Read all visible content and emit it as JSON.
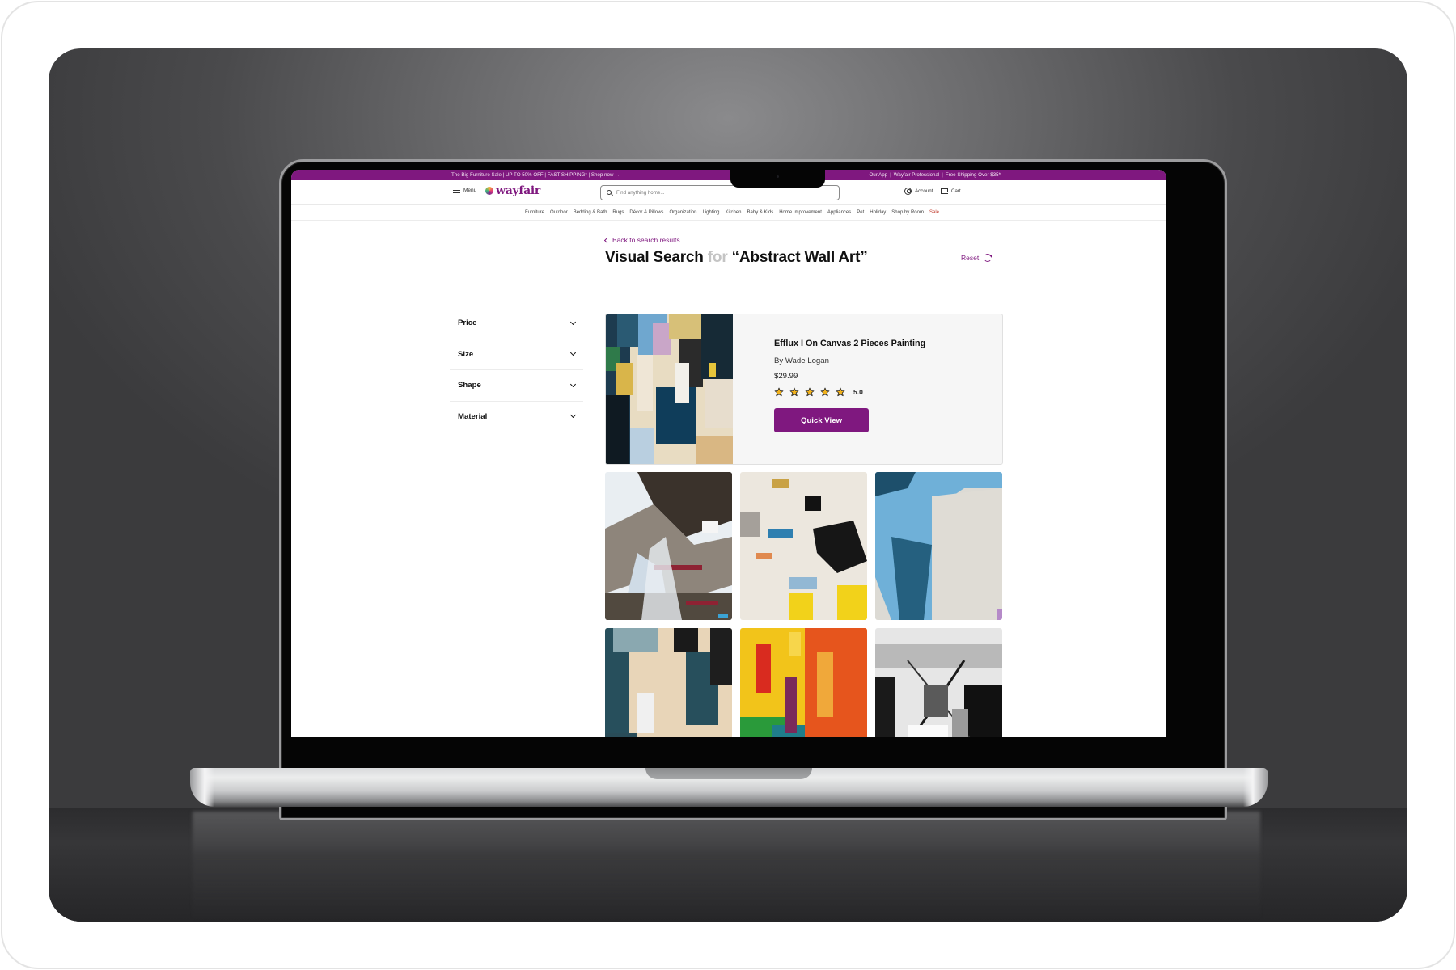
{
  "promo_bar": {
    "left_text": "The Big Furniture Sale | UP TO 50% OFF | FAST SHIPPING* | Shop now →",
    "right_items": [
      "Our App",
      "Wayfair Professional",
      "Free Shipping Over $35*"
    ]
  },
  "header": {
    "menu_label": "Menu",
    "logo_text": "wayfair",
    "search_placeholder": "Find anything home...",
    "search_value": "",
    "account_label": "Account",
    "cart_label": "Cart"
  },
  "category_nav": [
    "Furniture",
    "Outdoor",
    "Bedding & Bath",
    "Rugs",
    "Décor & Pillows",
    "Organization",
    "Lighting",
    "Kitchen",
    "Baby & Kids",
    "Home Improvement",
    "Appliances",
    "Pet",
    "Holiday",
    "Shop by Room",
    "Sale"
  ],
  "page": {
    "back_link": "Back to search results",
    "title_main": "Visual Search",
    "title_connector": "for",
    "title_query": "“Abstract Wall Art”",
    "reset_label": "Reset"
  },
  "filters": [
    {
      "label": "Price"
    },
    {
      "label": "Size"
    },
    {
      "label": "Shape"
    },
    {
      "label": "Material"
    }
  ],
  "featured_product": {
    "title": "Efflux I On Canvas 2 Pieces Painting",
    "brand": "By Wade Logan",
    "price": "$29.99",
    "rating_value": 5.0,
    "rating_label": "5.0",
    "stars_filled": 5,
    "stars_total": 5,
    "button_label": "Quick View"
  },
  "results": [
    {
      "name": "abstract-collage-brown-grey"
    },
    {
      "name": "abstract-collage-white-yellow"
    },
    {
      "name": "abstract-blue-white"
    },
    {
      "name": "abstract-teal-beige"
    },
    {
      "name": "abstract-yellow-red"
    },
    {
      "name": "abstract-black-white"
    }
  ],
  "colors": {
    "brand_purple": "#7f187f",
    "sale_red": "#c0392b",
    "star_gold": "#f2b21c"
  }
}
